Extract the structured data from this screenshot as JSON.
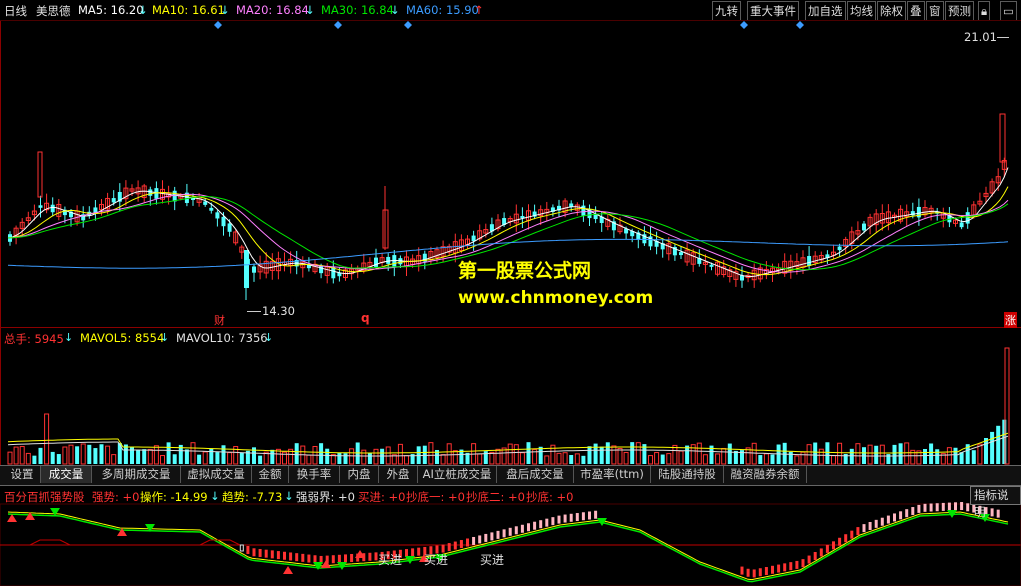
{
  "header": {
    "period": "日线",
    "stock": "美思德",
    "ma5": "MA5: 16.20",
    "ma10": "MA10: 16.61",
    "ma20": "MA20: 16.84",
    "ma30": "MA30: 16.84",
    "ma60": "MA60: 15.90"
  },
  "toolbar": [
    "九转",
    "重大事件",
    "加自选",
    "均线",
    "除权",
    "叠",
    "窗",
    "预测"
  ],
  "price_panel": {
    "high_label": "21.01",
    "low_label": "14.30",
    "marker_cai": "财",
    "marker_q": "q",
    "marker_zhang": "涨"
  },
  "watermark": {
    "line1": "第一股票公式网",
    "line2": "www.chnmoney.com"
  },
  "volume_panel": {
    "total": "总手: 5945",
    "mavol5": "MAVOL5: 8554",
    "mavol10": "MAVOL10: 7356"
  },
  "tabs": [
    "设置",
    "成交量",
    "多周期成交量",
    "虚拟成交量",
    "金额",
    "换手率",
    "内盘",
    "外盘",
    "AI立桩成交量",
    "盘后成交量",
    "市盈率(ttm)",
    "陆股通持股",
    "融资融券余额"
  ],
  "indicator_panel": {
    "name": "百分百抓强势股",
    "qiangshi": "强势: +0",
    "caozuo": "操作: -14.99",
    "qushi": "趋势: -7.73",
    "qiangruojie": "强弱界: +0",
    "maijin": "买进: +0",
    "chaodi1": "抄底一: +0",
    "chaodi2": "抄底二: +0",
    "chaodi": "抄底: +0",
    "help_button": "指标说明",
    "buy_label": "买进"
  },
  "colors": {
    "up": "#ff3232",
    "down": "#54ffff",
    "ma5": "#ffffff",
    "ma10": "#ffff00",
    "ma20": "#ff80ff",
    "ma30": "#00e600",
    "ma60": "#3c9cff"
  }
}
